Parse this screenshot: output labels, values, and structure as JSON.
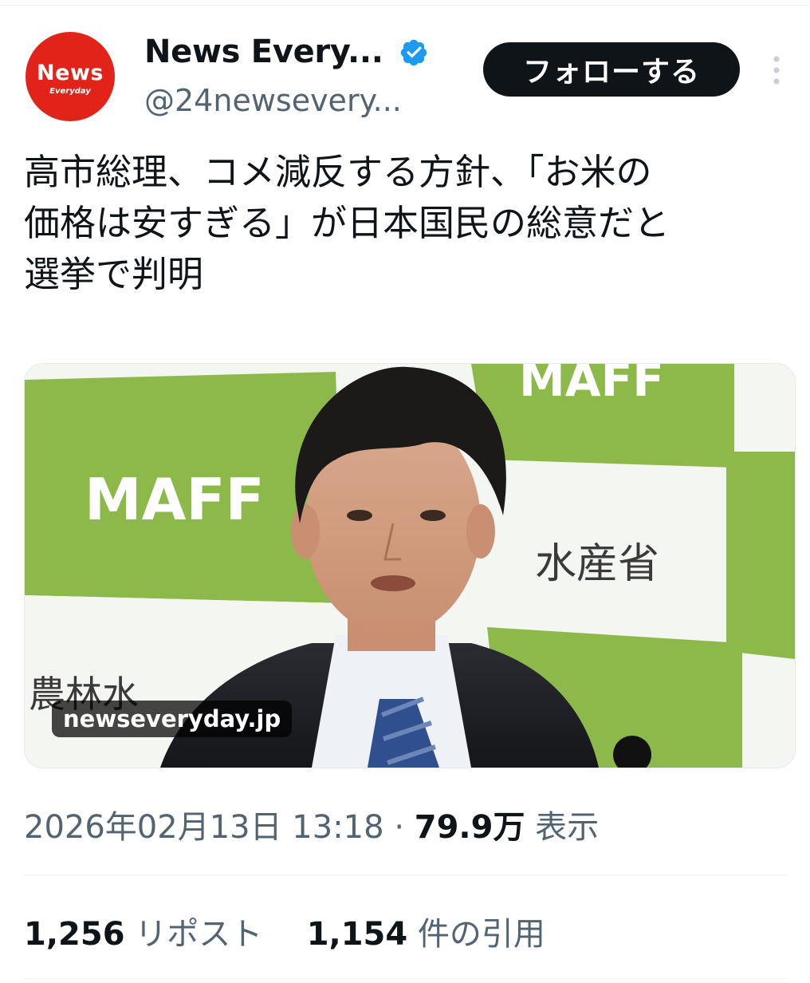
{
  "author": {
    "avatar_text": "News",
    "avatar_subtext": "Everyday",
    "display_name": "News Every...",
    "handle": "@24newsevery..."
  },
  "follow_label": "フォローする",
  "tweet_lines": [
    "高市総理、コメ減反する方針、「お米の",
    "価格は安すぎる」が日本国民の総意だと",
    "選挙で判明"
  ],
  "media": {
    "domain": "newseveryday.jp",
    "backdrop_text": {
      "logo": "MAFF",
      "ministry_fragment": "水産省",
      "ministry_left": "農林水"
    }
  },
  "meta": {
    "timestamp": "2026年02月13日 13:18",
    "separator": "·",
    "views_count": "79.9万",
    "views_label": "表示"
  },
  "stats": {
    "reposts_count": "1,256",
    "reposts_label": "リポスト",
    "quotes_count": "1,154",
    "quotes_label": "件の引用"
  },
  "colors": {
    "brand_red": "#e2231a",
    "verified_blue": "#1d9bf0",
    "text_primary": "#0f1419",
    "text_secondary": "#536471",
    "backdrop_green": "#8db94a"
  },
  "icons": [
    "verified-badge-icon",
    "more-options-icon"
  ]
}
